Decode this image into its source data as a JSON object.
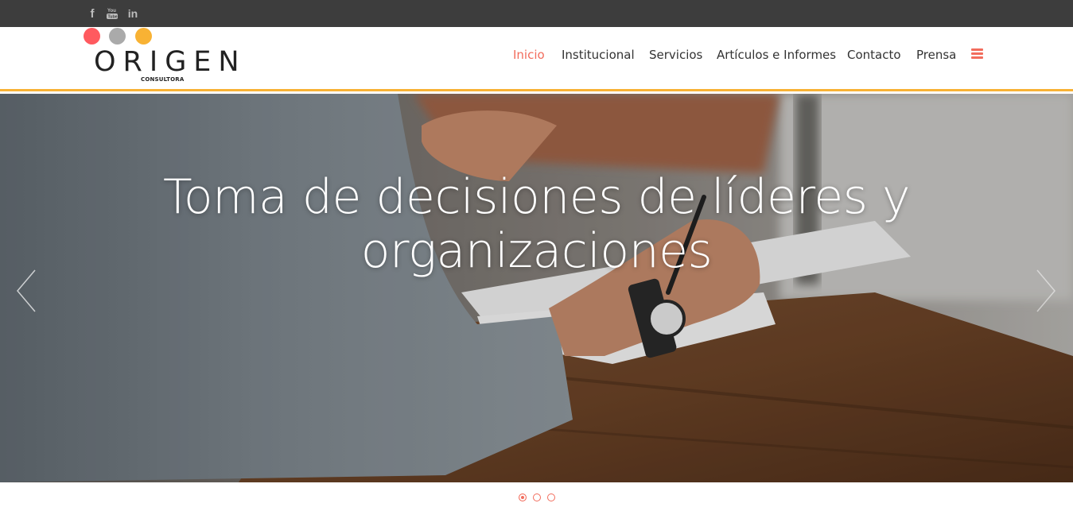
{
  "social": {
    "facebook_glyph": "f",
    "youtube_label": "You Tube",
    "linkedin_glyph": "in",
    "icon_color": "#bdbdbd"
  },
  "brand": {
    "name": "ORIGEN",
    "tagline": "CONSULTORA",
    "dot_colors": [
      "#ff5a5f",
      "#aaaaaa",
      "#f8b234"
    ]
  },
  "nav": {
    "items": [
      {
        "label": "Inicio",
        "active": true
      },
      {
        "label": "Institucional",
        "active": false
      },
      {
        "label": "Servicios",
        "active": false
      },
      {
        "label": "Artículos e Informes",
        "active": false
      },
      {
        "label": "Contacto",
        "active": false
      },
      {
        "label": "Prensa",
        "active": false
      }
    ],
    "accent_color": "#f26c5c",
    "menu_icon": "hamburger-menu-icon"
  },
  "hero": {
    "title_line1": "Toma de decisiones de líderes y",
    "title_line2": "organizaciones",
    "slide_count": 3,
    "active_slide": 1
  },
  "colors": {
    "topbar": "#3d3d3d",
    "header_border": "#f8b234"
  }
}
